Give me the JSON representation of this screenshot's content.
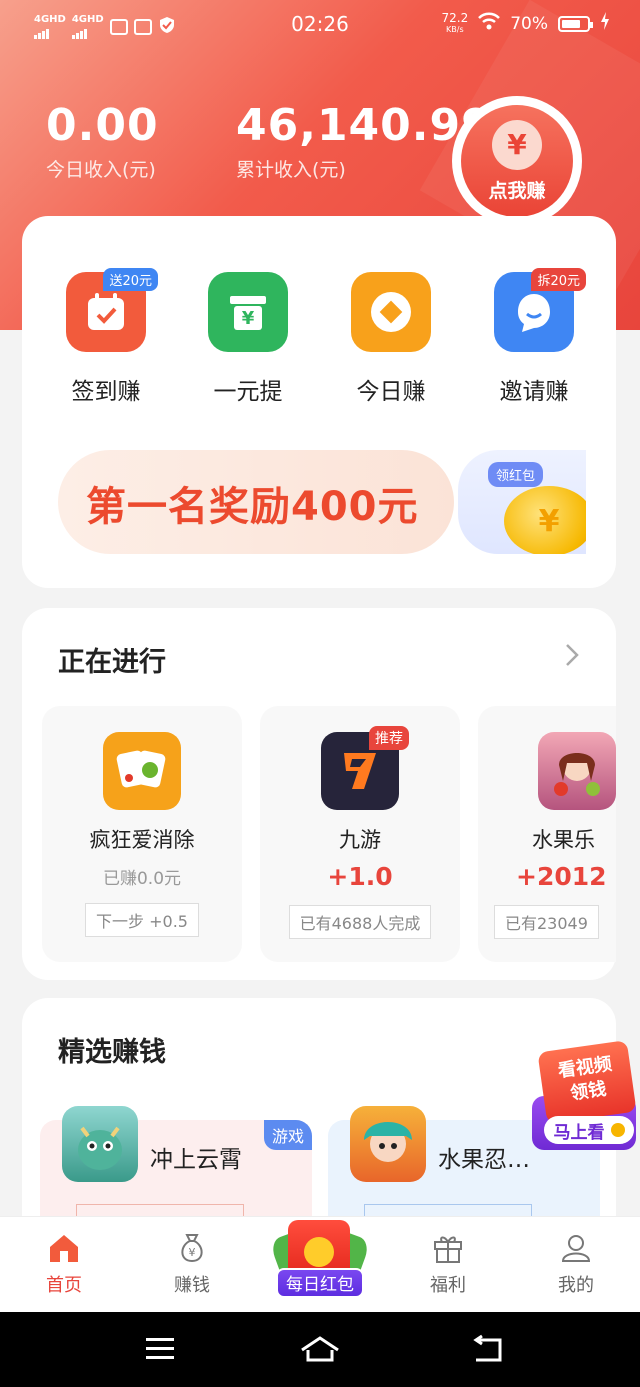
{
  "status": {
    "net1": "4GHD",
    "net2": "4GHD",
    "time": "02:26",
    "speed_value": "72.2",
    "speed_unit": "KB/s",
    "battery": "70%"
  },
  "header": {
    "today_value": "0.00",
    "today_label": "今日收入(元)",
    "total_value": "46,140.99",
    "total_label": "累计收入(元)",
    "action_symbol": "¥",
    "action_label": "点我赚"
  },
  "quick_actions": [
    {
      "label": "签到赚",
      "badge": "送20元",
      "color": "#f25b3c",
      "icon": "calendar-check-icon"
    },
    {
      "label": "一元提",
      "badge": "",
      "color": "#2fb55d",
      "icon": "yen-box-icon"
    },
    {
      "label": "今日赚",
      "badge": "",
      "color": "#f8a11b",
      "icon": "coin-icon"
    },
    {
      "label": "邀请赚",
      "badge": "拆20元",
      "color": "#3f86f3",
      "icon": "chat-face-icon"
    }
  ],
  "banner": {
    "text": "第一名奖励400元",
    "side_tag": "领红包",
    "coin_symbol": "¥"
  },
  "in_progress": {
    "title": "正在进行",
    "tasks": [
      {
        "name": "疯狂爱消除",
        "sub": "已赚0.0元",
        "reward": "",
        "pill": "下一步 +0.5",
        "badge": "",
        "icon": "mahjong-tile-icon"
      },
      {
        "name": "九游",
        "sub": "",
        "reward": "+1.0",
        "pill": "已有4688人完成",
        "badge": "推荐",
        "icon": "jiuyou-logo-icon"
      },
      {
        "name": "水果乐",
        "sub": "",
        "reward": "+2012",
        "pill": "已有23049",
        "badge": "",
        "icon": "game-avatar-icon"
      }
    ]
  },
  "picks": {
    "title": "精选赚钱",
    "items": [
      {
        "name": "冲上云霄",
        "tag": "游戏",
        "bg": "#fdeeee",
        "icon": "dragon-avatar-icon"
      },
      {
        "name": "水果忍…",
        "tag": "",
        "bg": "#eaf3fd",
        "icon": "ninja-avatar-icon"
      }
    ]
  },
  "float_ad": {
    "line1": "看视频",
    "line2": "领钱",
    "button": "马上看"
  },
  "tabs": [
    {
      "label": "首页",
      "icon": "home-icon",
      "active": true
    },
    {
      "label": "赚钱",
      "icon": "money-bag-icon",
      "active": false
    },
    {
      "label": "每日红包",
      "icon": "red-envelope-icon",
      "active": false
    },
    {
      "label": "福利",
      "icon": "gift-icon",
      "active": false
    },
    {
      "label": "我的",
      "icon": "user-icon",
      "active": false
    }
  ]
}
